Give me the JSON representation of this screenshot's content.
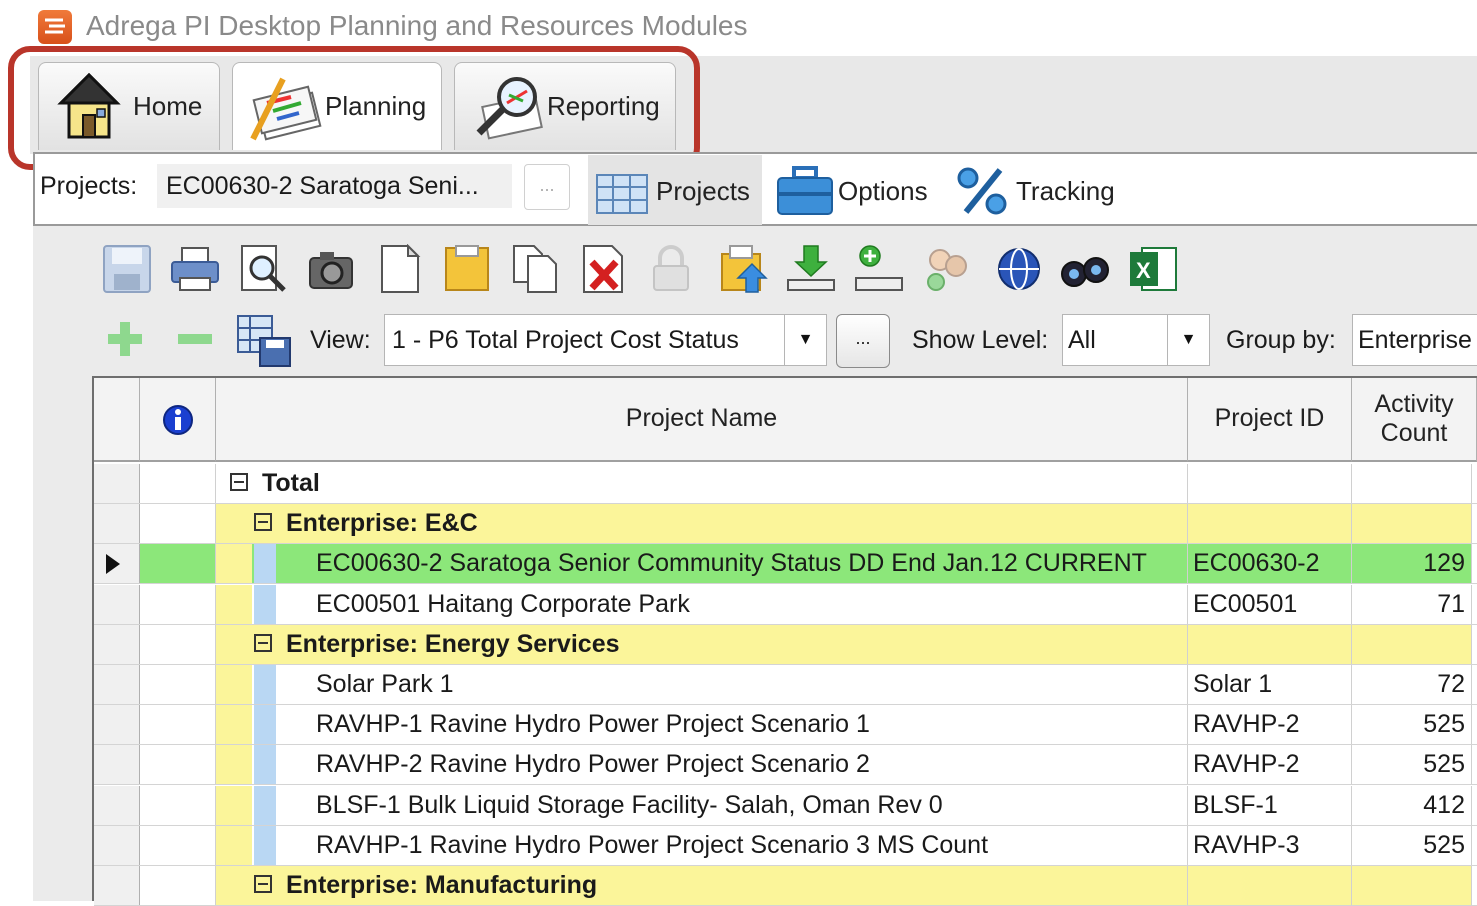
{
  "window": {
    "title": "Adrega PI Desktop Planning and Resources Modules"
  },
  "ribbon": {
    "tabs": [
      {
        "label": "Home",
        "icon": "house-icon"
      },
      {
        "label": "Planning",
        "icon": "planning-icon"
      },
      {
        "label": "Reporting",
        "icon": "reporting-icon"
      }
    ],
    "highlight_color": "#b9352a"
  },
  "subbar": {
    "projects_label": "Projects:",
    "projects_value": "EC00630-2 Saratoga Seni...",
    "browse_label": "...",
    "buttons": [
      {
        "label": "Projects",
        "icon": "grid-table-icon"
      },
      {
        "label": "Options",
        "icon": "toolbox-icon"
      },
      {
        "label": "Tracking",
        "icon": "percent-icon"
      }
    ]
  },
  "toolbar": {
    "icons": [
      "save-icon",
      "print-icon",
      "print-preview-icon",
      "camera-icon",
      "new-document-icon",
      "folder-icon",
      "copy-icon",
      "delete-icon",
      "lock-icon",
      "import-icon",
      "download-icon",
      "add-user-icon",
      "users-icon",
      "globe-icon",
      "binoculars-icon",
      "excel-icon"
    ]
  },
  "viewbar": {
    "view_label": "View:",
    "view_value": "1 - P6 Total Project Cost Status",
    "view_more": "...",
    "show_level_label": "Show Level:",
    "show_level_value": "All",
    "group_by_label": "Group by:",
    "group_by_value": "Enterprise"
  },
  "grid": {
    "columns": {
      "name": "Project Name",
      "id": "Project ID",
      "count_line1": "Activity",
      "count_line2": "Count"
    },
    "rows": [
      {
        "type": "total",
        "name": "Total",
        "id": "",
        "count": ""
      },
      {
        "type": "group",
        "name": "Enterprise: E&C",
        "id": "",
        "count": ""
      },
      {
        "type": "project",
        "selected": true,
        "name": "EC00630-2 Saratoga Senior Community Status DD End Jan.12 CURRENT",
        "id": "EC00630-2",
        "count": "129"
      },
      {
        "type": "project",
        "name": "EC00501 Haitang Corporate Park",
        "id": "EC00501",
        "count": "71"
      },
      {
        "type": "group",
        "name": "Enterprise: Energy Services",
        "id": "",
        "count": ""
      },
      {
        "type": "project",
        "name": "Solar Park 1",
        "id": "Solar 1",
        "count": "72"
      },
      {
        "type": "project",
        "name": "RAVHP-1 Ravine Hydro Power Project Scenario 1",
        "id": "RAVHP-2",
        "count": "525"
      },
      {
        "type": "project",
        "name": "RAVHP-2 Ravine Hydro Power Project Scenario 2",
        "id": "RAVHP-2",
        "count": "525"
      },
      {
        "type": "project",
        "name": "BLSF-1 Bulk Liquid Storage Facility- Salah, Oman Rev 0",
        "id": "BLSF-1",
        "count": "412"
      },
      {
        "type": "project",
        "name": "RAVHP-1 Ravine Hydro Power Project Scenario 3 MS Count",
        "id": "RAVHP-3",
        "count": "525"
      },
      {
        "type": "group",
        "name": "Enterprise: Manufacturing",
        "id": "",
        "count": ""
      }
    ]
  },
  "colors": {
    "group_row": "#fbf59a",
    "selected_row": "#8ce77a",
    "indent_strip": "#b9d7f3"
  }
}
